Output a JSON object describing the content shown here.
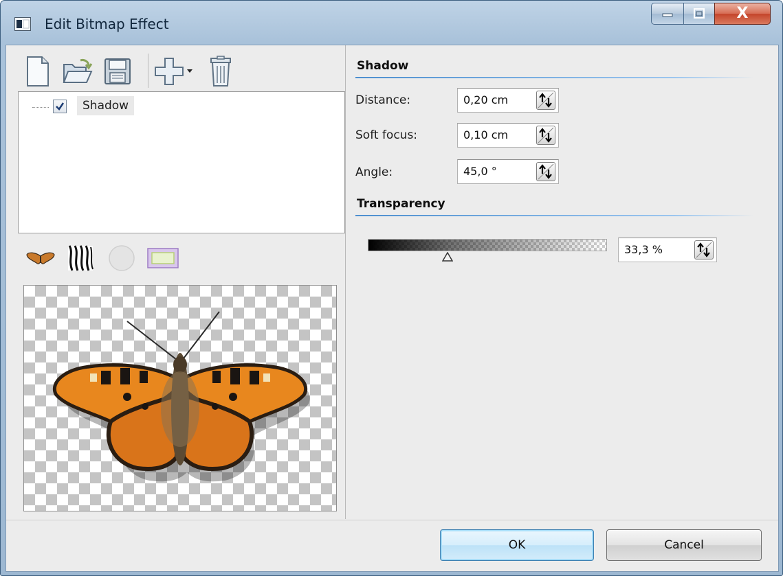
{
  "window": {
    "title": "Edit Bitmap Effect",
    "controls": [
      "minimize",
      "maximize",
      "close"
    ],
    "close_glyph": "X"
  },
  "toolbar": {
    "items": [
      {
        "icon": "new-document-icon",
        "tooltip": ""
      },
      {
        "icon": "open-folder-icon",
        "tooltip": ""
      },
      {
        "icon": "save-floppy-icon",
        "tooltip": ""
      },
      {
        "icon": "add-plus-dropdown-icon",
        "tooltip": ""
      },
      {
        "icon": "trash-icon",
        "tooltip": ""
      }
    ]
  },
  "effects_tree": {
    "items": [
      {
        "label": "Shadow",
        "checked": true
      }
    ]
  },
  "preview_toolbar": {
    "items": [
      "butterfly-preview-icon",
      "zebra-preview-icon",
      "circle-preview-icon",
      "rectangle-preview-icon"
    ]
  },
  "shadow": {
    "section_title": "Shadow",
    "distance": {
      "label": "Distance:",
      "value": "0,20 cm"
    },
    "soft_focus": {
      "label": "Soft focus:",
      "value": "0,10 cm"
    },
    "angle": {
      "label": "Angle:",
      "value": "45,0 °"
    }
  },
  "transparency": {
    "section_title": "Transparency",
    "value_text": "33,3 %",
    "level": 0.333
  },
  "buttons": {
    "ok": "OK",
    "cancel": "Cancel"
  },
  "colors": {
    "section_underline": "#4d8fcf",
    "ok_button_accent": "#3c7fb1",
    "close_button": "#c4452b"
  }
}
